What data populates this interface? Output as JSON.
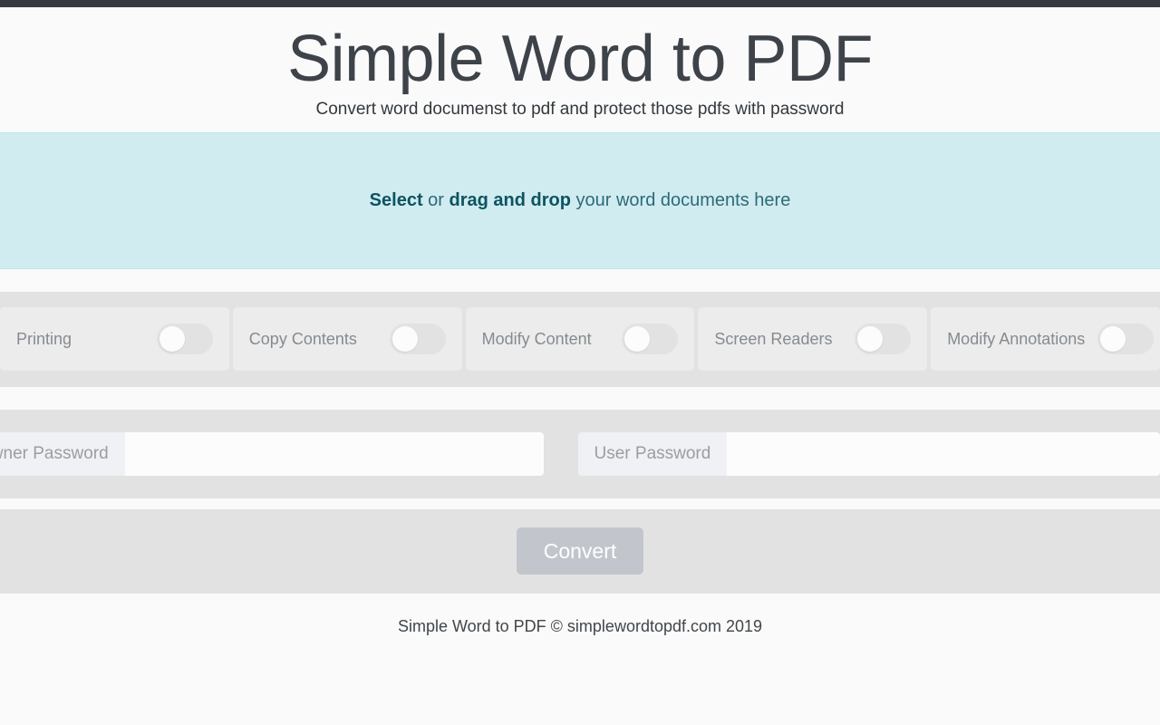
{
  "page": {
    "background_color": "#fafafa",
    "navbar_color": "#343a40"
  },
  "header": {
    "title": "Simple Word to PDF",
    "subtitle": "Convert word documenst to pdf and protect those pdfs with password"
  },
  "dropzone": {
    "accent_color": "#d1ecf1",
    "text_color": "#0c5460",
    "select_label": "Select",
    "conjunction": " or ",
    "drag_label": "drag and drop",
    "suffix": " your word documents here"
  },
  "permissions": {
    "items": [
      {
        "label": "Printing",
        "enabled": false
      },
      {
        "label": "Copy Contents",
        "enabled": false
      },
      {
        "label": "Modify Content",
        "enabled": false
      },
      {
        "label": "Screen Readers",
        "enabled": false
      },
      {
        "label": "Modify Annotations",
        "enabled": false
      }
    ]
  },
  "passwords": {
    "owner": {
      "label": "Owner Password",
      "value": "",
      "placeholder": ""
    },
    "user": {
      "label": "User Password",
      "value": "",
      "placeholder": ""
    }
  },
  "actions": {
    "convert_label": "Convert",
    "convert_color": "#c2c6cc"
  },
  "footer": {
    "text": "Simple Word to PDF © simplewordtopdf.com 2019"
  }
}
